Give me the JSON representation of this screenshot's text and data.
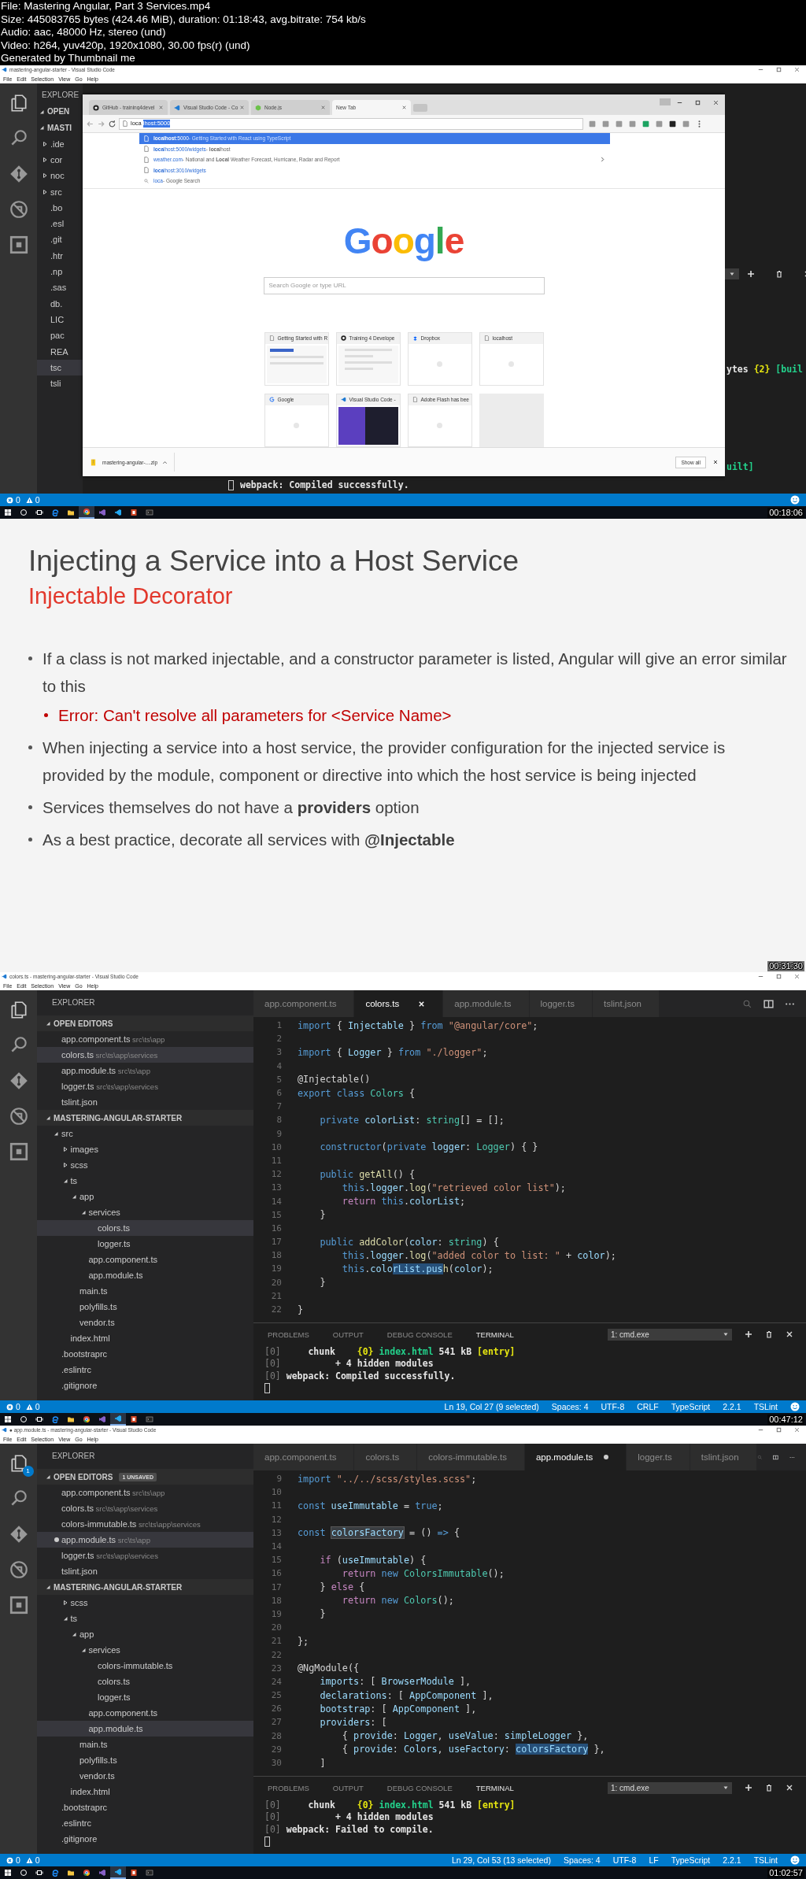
{
  "header_lines": [
    "File: Mastering Angular, Part 3 Services.mp4",
    "Size: 445083765 bytes (424.46 MiB), duration: 01:18:43, avg.bitrate: 754 kb/s",
    "Audio: aac, 48000 Hz, stereo (und)",
    "Video: h264, yuv420p, 1920x1080, 30.00 fps(r) (und)",
    "Generated by Thumbnail me"
  ],
  "frames": [
    {
      "kind": "browser",
      "title": "mastering-angular-starter - Visual Studio Code",
      "menu": [
        "File",
        "Edit",
        "Selection",
        "View",
        "Go",
        "Help"
      ],
      "sidebar_fragments": [
        {
          "kind": "header",
          "text": "EXPLORE",
          "selected": false
        },
        {
          "kind": "section",
          "text": "OPEN",
          "selected": false
        },
        {
          "kind": "section",
          "text": "MASTI",
          "selected": false
        },
        {
          "kind": "folder",
          "text": ".ide",
          "selected": false
        },
        {
          "kind": "folder",
          "text": "cor",
          "selected": false
        },
        {
          "kind": "folder",
          "text": "noc",
          "selected": false
        },
        {
          "kind": "folder",
          "text": "src",
          "selected": false
        },
        {
          "kind": "file",
          "text": ".bo",
          "selected": false
        },
        {
          "kind": "file",
          "text": ".esl",
          "selected": false
        },
        {
          "kind": "file",
          "text": ".git",
          "selected": false
        },
        {
          "kind": "file",
          "text": ".htr",
          "selected": false
        },
        {
          "kind": "file",
          "text": ".np",
          "selected": false
        },
        {
          "kind": "file",
          "text": ".sas",
          "selected": false
        },
        {
          "kind": "file",
          "text": "db.",
          "selected": false
        },
        {
          "kind": "file",
          "text": "LIC",
          "selected": false
        },
        {
          "kind": "file",
          "text": "pac",
          "selected": false
        },
        {
          "kind": "file",
          "text": "REA",
          "selected": false
        },
        {
          "kind": "file",
          "text": "tsc",
          "selected": true
        },
        {
          "kind": "file",
          "text": "tsli",
          "selected": false
        }
      ],
      "terminal_fragments": [
        {
          "segments": [
            {
              "kind": "bold",
              "text": "ytes "
            },
            {
              "kind": "yellow",
              "text": "{2}"
            },
            {
              "kind": "green",
              "text": " [buil"
            }
          ]
        },
        {
          "segments": [
            {
              "kind": "green",
              "text": "uilt]"
            }
          ]
        }
      ],
      "terminal_bottom": "webpack: Compiled successfully.",
      "browser": {
        "tabs": [
          {
            "kind": "github",
            "title": "GitHub - training4devel",
            "selected": false
          },
          {
            "kind": "vscode",
            "title": "Visual Studio Code - Co",
            "selected": false
          },
          {
            "kind": "node",
            "title": "Node.js",
            "selected": false
          },
          {
            "kind": "blank",
            "title": "New Tab",
            "selected": true
          }
        ],
        "address": {
          "typed": "loca",
          "completion": "lhost:5000"
        },
        "suggestions": [
          {
            "kind": "page",
            "url": "**localhost**:5000",
            "title": "- Getting Started with React using TypeScript",
            "selected": true,
            "expandable": false
          },
          {
            "kind": "page",
            "url": "**loca**lhost:5000/widgets",
            "title": "- **loca**lhost",
            "selected": false,
            "expandable": false
          },
          {
            "kind": "page",
            "url": "weather.com",
            "title": "- National and **Local** Weather Forecast, Hurricane, Radar and Report",
            "selected": false,
            "expandable": true
          },
          {
            "kind": "page",
            "url": "**loca**lhost:3010/widgets",
            "selected": false,
            "expandable": false
          },
          {
            "kind": "search",
            "url": "loca",
            "title": "- Google Search",
            "selected": false,
            "expandable": false
          }
        ],
        "logo": [
          {
            "char": "G",
            "color": "#4285f4"
          },
          {
            "char": "o",
            "color": "#ea4335"
          },
          {
            "char": "o",
            "color": "#fbbc05"
          },
          {
            "char": "g",
            "color": "#4285f4"
          },
          {
            "char": "l",
            "color": "#34a853"
          },
          {
            "char": "e",
            "color": "#ea4335"
          }
        ],
        "search_placeholder": "Search Google or type URL",
        "tiles": [
          {
            "kind": "page",
            "title": "Getting Started with R"
          },
          {
            "kind": "github",
            "title": "Training 4 Develope"
          },
          {
            "kind": "dropbox",
            "title": "Dropbox"
          },
          {
            "kind": "page",
            "title": "localhost"
          },
          {
            "kind": "google",
            "title": "Google"
          },
          {
            "kind": "vscode",
            "title": "Visual Studio Code -"
          },
          {
            "kind": "page",
            "title": "Adobe Flash has bee"
          },
          {
            "kind": "empty"
          }
        ],
        "download": {
          "file": "mastering-angular-....zip",
          "button": "Show all"
        }
      },
      "status": {
        "errors": "0",
        "warnings": "0"
      },
      "taskbar": [
        {
          "kind": "start",
          "active": false
        },
        {
          "kind": "search",
          "active": false
        },
        {
          "kind": "taskview",
          "active": false
        },
        {
          "kind": "edge",
          "active": false
        },
        {
          "kind": "folder",
          "active": false
        },
        {
          "kind": "chrome",
          "active": true
        },
        {
          "kind": "visualstudio",
          "active": false
        },
        {
          "kind": "vscode",
          "active": false
        },
        {
          "kind": "powerpoint",
          "active": false
        },
        {
          "kind": "terminal",
          "active": false
        }
      ],
      "timestamp": "00:18:06"
    },
    {
      "kind": "slide",
      "title": "Injecting a Service into a Host Service",
      "subtitle": "Injectable Decorator",
      "bullets": [
        {
          "text": "If a class is not marked injectable, and a constructor parameter is listed, Angular will give an error similar to this",
          "children": [
            {
              "text": "Error: Can't resolve all parameters for <Service Name>"
            }
          ]
        },
        {
          "text": "When injecting a service into a host service, the provider configuration for the injected service is provided by the module, component or directive into which the host service is being injected"
        },
        {
          "text": "Services themselves do not have a **providers** option"
        },
        {
          "text": "As a best practice, decorate all services with **@Injectable**"
        }
      ],
      "timestamp": "00:31:30"
    },
    {
      "kind": "editor",
      "title": "colors.ts - mastering-angular-starter - Visual Studio Code",
      "menu": [
        "File",
        "Edit",
        "Selection",
        "View",
        "Go",
        "Help"
      ],
      "explorer": {
        "title": "EXPLORER",
        "open_editors": {
          "label": "OPEN EDITORS",
          "items": [
            {
              "name": "app.component.ts",
              "path": "src\\ts\\app",
              "selected": false,
              "dirty": false
            },
            {
              "name": "colors.ts",
              "path": "src\\ts\\app\\services",
              "selected": true,
              "dirty": false
            },
            {
              "name": "app.module.ts",
              "path": "src\\ts\\app",
              "selected": false,
              "dirty": false
            },
            {
              "name": "logger.ts",
              "path": "src\\ts\\app\\services",
              "selected": false,
              "dirty": false
            },
            {
              "name": "tslint.json",
              "selected": false,
              "dirty": false
            }
          ]
        },
        "project": "MASTERING-ANGULAR-STARTER",
        "tree": [
          {
            "kind": "folder",
            "name": "src",
            "expanded": true,
            "selected": false,
            "children": [
              {
                "kind": "folder",
                "name": "images",
                "expanded": false,
                "selected": false
              },
              {
                "kind": "folder",
                "name": "scss",
                "expanded": false,
                "selected": false
              },
              {
                "kind": "folder",
                "name": "ts",
                "expanded": true,
                "selected": false,
                "children": [
                  {
                    "kind": "folder",
                    "name": "app",
                    "expanded": true,
                    "selected": false,
                    "children": [
                      {
                        "kind": "folder",
                        "name": "services",
                        "expanded": true,
                        "selected": false,
                        "children": [
                          {
                            "kind": "file",
                            "name": "colors.ts",
                            "selected": true
                          },
                          {
                            "kind": "file",
                            "name": "logger.ts",
                            "selected": false
                          }
                        ]
                      },
                      {
                        "kind": "file",
                        "name": "app.component.ts",
                        "selected": false
                      },
                      {
                        "kind": "file",
                        "name": "app.module.ts",
                        "selected": false
                      }
                    ]
                  },
                  {
                    "kind": "file",
                    "name": "main.ts",
                    "selected": false
                  },
                  {
                    "kind": "file",
                    "name": "polyfills.ts",
                    "selected": false
                  },
                  {
                    "kind": "file",
                    "name": "vendor.ts",
                    "selected": false
                  }
                ]
              },
              {
                "kind": "file",
                "name": "index.html",
                "selected": false
              }
            ]
          },
          {
            "kind": "file",
            "name": ".bootstraprc",
            "selected": false
          },
          {
            "kind": "file",
            "name": ".eslintrc",
            "selected": false
          },
          {
            "kind": "file",
            "name": ".gitignore",
            "selected": false
          }
        ]
      },
      "tabs": [
        {
          "name": "app.component.ts",
          "selected": false,
          "dirty": false
        },
        {
          "name": "colors.ts",
          "selected": true,
          "dirty": false
        },
        {
          "name": "app.module.ts",
          "selected": false,
          "dirty": false
        },
        {
          "name": "logger.ts",
          "selected": false,
          "dirty": false
        },
        {
          "name": "tslint.json",
          "selected": false,
          "dirty": false
        }
      ],
      "code": [
        {
          "number": "1",
          "tokens": [
            {
              "kind": "kw",
              "text": "import"
            },
            {
              "kind": "plain",
              "text": " { "
            },
            {
              "kind": "var",
              "text": "Injectable"
            },
            {
              "kind": "plain",
              "text": " } "
            },
            {
              "kind": "kw",
              "text": "from"
            },
            {
              "kind": "str",
              "text": " \"@angular/core\""
            },
            {
              "kind": "plain",
              "text": ";"
            }
          ]
        },
        {
          "number": "2"
        },
        {
          "number": "3",
          "tokens": [
            {
              "kind": "kw",
              "text": "import"
            },
            {
              "kind": "plain",
              "text": " { "
            },
            {
              "kind": "var",
              "text": "Logger"
            },
            {
              "kind": "plain",
              "text": " } "
            },
            {
              "kind": "kw",
              "text": "from"
            },
            {
              "kind": "str",
              "text": " \"./logger\""
            },
            {
              "kind": "plain",
              "text": ";"
            }
          ]
        },
        {
          "number": "4"
        },
        {
          "number": "5",
          "tokens": [
            {
              "kind": "plain",
              "text": "@Injectable()"
            }
          ]
        },
        {
          "number": "6",
          "tokens": [
            {
              "kind": "kw",
              "text": "export class"
            },
            {
              "kind": "type",
              "text": " Colors"
            },
            {
              "kind": "plain",
              "text": " {"
            }
          ]
        },
        {
          "number": "7"
        },
        {
          "number": "8",
          "tokens": [
            {
              "kind": "kw",
              "text": "    private"
            },
            {
              "kind": "var",
              "text": " colorList"
            },
            {
              "kind": "plain",
              "text": ": "
            },
            {
              "kind": "type",
              "text": "string"
            },
            {
              "kind": "plain",
              "text": "[] = [];"
            }
          ]
        },
        {
          "number": "9"
        },
        {
          "number": "10",
          "tokens": [
            {
              "kind": "kw",
              "text": "    constructor"
            },
            {
              "kind": "plain",
              "text": "("
            },
            {
              "kind": "kw",
              "text": "private"
            },
            {
              "kind": "var",
              "text": " logger"
            },
            {
              "kind": "plain",
              "text": ": "
            },
            {
              "kind": "type",
              "text": "Logger"
            },
            {
              "kind": "plain",
              "text": ") { }"
            }
          ]
        },
        {
          "number": "11"
        },
        {
          "number": "12",
          "tokens": [
            {
              "kind": "kw",
              "text": "    public"
            },
            {
              "kind": "fn",
              "text": " getAll"
            },
            {
              "kind": "plain",
              "text": "() {"
            }
          ]
        },
        {
          "number": "13",
          "tokens": [
            {
              "kind": "kw",
              "text": "        this"
            },
            {
              "kind": "plain",
              "text": "."
            },
            {
              "kind": "var",
              "text": "logger"
            },
            {
              "kind": "plain",
              "text": "."
            },
            {
              "kind": "fn",
              "text": "log"
            },
            {
              "kind": "plain",
              "text": "("
            },
            {
              "kind": "str",
              "text": "\"retrieved color list\""
            },
            {
              "kind": "plain",
              "text": ");"
            }
          ]
        },
        {
          "number": "14",
          "tokens": [
            {
              "kind": "ctrl",
              "text": "        return"
            },
            {
              "kind": "kw",
              "text": " this"
            },
            {
              "kind": "plain",
              "text": "."
            },
            {
              "kind": "var",
              "text": "colorList"
            },
            {
              "kind": "plain",
              "text": ";"
            }
          ]
        },
        {
          "number": "15",
          "tokens": [
            {
              "kind": "plain",
              "text": "    }"
            }
          ]
        },
        {
          "number": "16"
        },
        {
          "number": "17",
          "tokens": [
            {
              "kind": "kw",
              "text": "    public"
            },
            {
              "kind": "fn",
              "text": " addColor"
            },
            {
              "kind": "plain",
              "text": "("
            },
            {
              "kind": "var",
              "text": "color"
            },
            {
              "kind": "plain",
              "text": ": "
            },
            {
              "kind": "type",
              "text": "string"
            },
            {
              "kind": "plain",
              "text": ") {"
            }
          ]
        },
        {
          "number": "18",
          "tokens": [
            {
              "kind": "kw",
              "text": "        this"
            },
            {
              "kind": "plain",
              "text": "."
            },
            {
              "kind": "var",
              "text": "logger"
            },
            {
              "kind": "plain",
              "text": "."
            },
            {
              "kind": "fn",
              "text": "log"
            },
            {
              "kind": "plain",
              "text": "("
            },
            {
              "kind": "str",
              "text": "\"added color to list: \""
            },
            {
              "kind": "plain",
              "text": " + "
            },
            {
              "kind": "var",
              "text": "color"
            },
            {
              "kind": "plain",
              "text": ");"
            }
          ]
        },
        {
          "number": "19",
          "tokens": [
            {
              "kind": "kw",
              "text": "        this"
            },
            {
              "kind": "plain",
              "text": "."
            },
            {
              "kind": "var",
              "text": "colo"
            },
            {
              "kind": "sel",
              "text": "rList.pus"
            },
            {
              "kind": "fn",
              "text": "h"
            },
            {
              "kind": "plain",
              "text": "("
            },
            {
              "kind": "var",
              "text": "color"
            },
            {
              "kind": "plain",
              "text": ");"
            }
          ]
        },
        {
          "number": "20",
          "tokens": [
            {
              "kind": "plain",
              "text": "    }"
            }
          ]
        },
        {
          "number": "21"
        },
        {
          "number": "22",
          "tokens": [
            {
              "kind": "plain",
              "text": "}"
            }
          ]
        }
      ],
      "panel": {
        "tabs": [
          {
            "label": "PROBLEMS",
            "selected": false
          },
          {
            "label": "OUTPUT",
            "selected": false
          },
          {
            "label": "DEBUG CONSOLE",
            "selected": false
          },
          {
            "label": "TERMINAL",
            "selected": true
          }
        ],
        "terminal_select": "1: cmd.exe",
        "lines": [
          {
            "segments": [
              {
                "kind": "dim",
                "text": "[0]"
              },
              {
                "kind": "bold",
                "text": "     chunk    "
              },
              {
                "kind": "yellow",
                "text": "{0}"
              },
              {
                "kind": "green",
                "text": " index.html"
              },
              {
                "kind": "bold",
                "text": " 541 kB "
              },
              {
                "kind": "yellow",
                "text": "[entry]"
              }
            ]
          },
          {
            "segments": [
              {
                "kind": "dim",
                "text": "[0]"
              },
              {
                "kind": "bold",
                "text": "          + 4 hidden modules"
              }
            ]
          },
          {
            "segments": [
              {
                "kind": "dim",
                "text": "[0]"
              },
              {
                "kind": "bold",
                "text": " webpack: Compiled successfully."
              }
            ]
          }
        ]
      },
      "status": {
        "errors": "0",
        "warnings": "0",
        "items": [
          "Ln 19, Col 27 (9 selected)",
          "Spaces: 4",
          "UTF-8",
          "CRLF",
          "TypeScript",
          "2.2.1",
          "TSLint"
        ]
      },
      "taskbar": [
        {
          "kind": "start",
          "active": false
        },
        {
          "kind": "search",
          "active": false
        },
        {
          "kind": "taskview",
          "active": false
        },
        {
          "kind": "edge",
          "active": false
        },
        {
          "kind": "folder",
          "active": false
        },
        {
          "kind": "chrome",
          "active": false
        },
        {
          "kind": "visualstudio",
          "active": false
        },
        {
          "kind": "vscode",
          "active": true
        },
        {
          "kind": "powerpoint",
          "active": false
        },
        {
          "kind": "terminal",
          "active": false
        }
      ],
      "timestamp": "00:47:12"
    },
    {
      "kind": "editor",
      "title": "● app.module.ts - mastering-angular-starter - Visual Studio Code",
      "menu": [
        "File",
        "Edit",
        "Selection",
        "View",
        "Go",
        "Help"
      ],
      "explorer_badge": "1",
      "explorer": {
        "title": "EXPLORER",
        "open_editors": {
          "label": "OPEN EDITORS",
          "badge": "1 UNSAVED",
          "items": [
            {
              "name": "app.component.ts",
              "path": "src\\ts\\app",
              "selected": false,
              "dirty": false
            },
            {
              "name": "colors.ts",
              "path": "src\\ts\\app\\services",
              "selected": false,
              "dirty": false
            },
            {
              "name": "colors-immutable.ts",
              "path": "src\\ts\\app\\services",
              "selected": false,
              "dirty": false
            },
            {
              "name": "app.module.ts",
              "path": "src\\ts\\app",
              "selected": true,
              "dirty": true
            },
            {
              "name": "logger.ts",
              "path": "src\\ts\\app\\services",
              "selected": false,
              "dirty": false
            },
            {
              "name": "tslint.json",
              "selected": false,
              "dirty": false
            }
          ]
        },
        "project": "MASTERING-ANGULAR-STARTER",
        "tree": [
          {
            "children": [
              {
                "kind": "folder",
                "name": "scss",
                "expanded": false,
                "selected": false
              },
              {
                "kind": "folder",
                "name": "ts",
                "expanded": true,
                "selected": false,
                "children": [
                  {
                    "kind": "folder",
                    "name": "app",
                    "expanded": true,
                    "selected": false,
                    "children": [
                      {
                        "kind": "folder",
                        "name": "services",
                        "expanded": true,
                        "selected": false,
                        "children": [
                          {
                            "kind": "file",
                            "name": "colors-immutable.ts",
                            "selected": false
                          },
                          {
                            "kind": "file",
                            "name": "colors.ts",
                            "selected": false
                          },
                          {
                            "kind": "file",
                            "name": "logger.ts",
                            "selected": false
                          }
                        ]
                      },
                      {
                        "kind": "file",
                        "name": "app.component.ts",
                        "selected": false
                      },
                      {
                        "kind": "file",
                        "name": "app.module.ts",
                        "selected": true
                      }
                    ]
                  },
                  {
                    "kind": "file",
                    "name": "main.ts",
                    "selected": false
                  },
                  {
                    "kind": "file",
                    "name": "polyfills.ts",
                    "selected": false
                  },
                  {
                    "kind": "file",
                    "name": "vendor.ts",
                    "selected": false
                  }
                ]
              },
              {
                "kind": "file",
                "name": "index.html",
                "selected": false
              }
            ]
          },
          {
            "kind": "file",
            "name": ".bootstraprc",
            "selected": false
          },
          {
            "kind": "file",
            "name": ".eslintrc",
            "selected": false
          },
          {
            "kind": "file",
            "name": ".gitignore",
            "selected": false
          }
        ]
      },
      "tabs": [
        {
          "name": "app.component.ts",
          "selected": false,
          "dirty": false
        },
        {
          "name": "colors.ts",
          "selected": false,
          "dirty": false
        },
        {
          "name": "colors-immutable.ts",
          "selected": false,
          "dirty": false
        },
        {
          "name": "app.module.ts",
          "selected": true,
          "dirty": true
        },
        {
          "name": "logger.ts",
          "selected": false,
          "dirty": false
        },
        {
          "name": "tslint.json",
          "selected": false,
          "dirty": false
        }
      ],
      "code": [
        {
          "number": "9",
          "tokens": [
            {
              "kind": "kw",
              "text": "import"
            },
            {
              "kind": "str",
              "text": " \"../../scss/styles.scss\""
            },
            {
              "kind": "plain",
              "text": ";"
            }
          ]
        },
        {
          "number": "10"
        },
        {
          "number": "11",
          "tokens": [
            {
              "kind": "kw",
              "text": "const"
            },
            {
              "kind": "var",
              "text": " useImmutable"
            },
            {
              "kind": "plain",
              "text": " = "
            },
            {
              "kind": "kw",
              "text": "true"
            },
            {
              "kind": "plain",
              "text": ";"
            }
          ]
        },
        {
          "number": "12"
        },
        {
          "number": "13",
          "tokens": [
            {
              "kind": "kw",
              "text": "const "
            },
            {
              "kind": "hl",
              "text": "colorsFactory"
            },
            {
              "kind": "plain",
              "text": " = () "
            },
            {
              "kind": "kw",
              "text": "=>"
            },
            {
              "kind": "plain",
              "text": " {"
            }
          ]
        },
        {
          "number": "14"
        },
        {
          "number": "15",
          "tokens": [
            {
              "kind": "ctrl",
              "text": "    if"
            },
            {
              "kind": "plain",
              "text": " ("
            },
            {
              "kind": "var",
              "text": "useImmutable"
            },
            {
              "kind": "plain",
              "text": ") {"
            }
          ]
        },
        {
          "number": "16",
          "tokens": [
            {
              "kind": "ctrl",
              "text": "        return"
            },
            {
              "kind": "kw",
              "text": " new"
            },
            {
              "kind": "type",
              "text": " ColorsImmutable"
            },
            {
              "kind": "plain",
              "text": "();"
            }
          ]
        },
        {
          "number": "17",
          "tokens": [
            {
              "kind": "plain",
              "text": "    } "
            },
            {
              "kind": "ctrl",
              "text": "else"
            },
            {
              "kind": "plain",
              "text": " {"
            }
          ]
        },
        {
          "number": "18",
          "tokens": [
            {
              "kind": "ctrl",
              "text": "        return"
            },
            {
              "kind": "kw",
              "text": " new"
            },
            {
              "kind": "type",
              "text": " Colors"
            },
            {
              "kind": "plain",
              "text": "();"
            }
          ]
        },
        {
          "number": "19",
          "tokens": [
            {
              "kind": "plain",
              "text": "    }"
            }
          ]
        },
        {
          "number": "20"
        },
        {
          "number": "21",
          "tokens": [
            {
              "kind": "plain",
              "text": "};"
            }
          ]
        },
        {
          "number": "22"
        },
        {
          "number": "23",
          "tokens": [
            {
              "kind": "plain",
              "text": "@NgModule({"
            }
          ]
        },
        {
          "number": "24",
          "tokens": [
            {
              "kind": "var",
              "text": "    imports"
            },
            {
              "kind": "plain",
              "text": ": [ "
            },
            {
              "kind": "var",
              "text": "BrowserModule"
            },
            {
              "kind": "plain",
              "text": " ],"
            }
          ]
        },
        {
          "number": "25",
          "tokens": [
            {
              "kind": "var",
              "text": "    declarations"
            },
            {
              "kind": "plain",
              "text": ": [ "
            },
            {
              "kind": "var",
              "text": "AppComponent"
            },
            {
              "kind": "plain",
              "text": " ],"
            }
          ]
        },
        {
          "number": "26",
          "tokens": [
            {
              "kind": "var",
              "text": "    bootstrap"
            },
            {
              "kind": "plain",
              "text": ": [ "
            },
            {
              "kind": "var",
              "text": "AppComponent"
            },
            {
              "kind": "plain",
              "text": " ],"
            }
          ]
        },
        {
          "number": "27",
          "tokens": [
            {
              "kind": "var",
              "text": "    providers"
            },
            {
              "kind": "plain",
              "text": ": ["
            }
          ]
        },
        {
          "number": "28",
          "tokens": [
            {
              "kind": "plain",
              "text": "        { "
            },
            {
              "kind": "var",
              "text": "provide"
            },
            {
              "kind": "plain",
              "text": ": "
            },
            {
              "kind": "var",
              "text": "Logger"
            },
            {
              "kind": "plain",
              "text": ", "
            },
            {
              "kind": "var",
              "text": "useValue"
            },
            {
              "kind": "plain",
              "text": ": "
            },
            {
              "kind": "var",
              "text": "simpleLogger"
            },
            {
              "kind": "plain",
              "text": " },"
            }
          ]
        },
        {
          "number": "29",
          "tokens": [
            {
              "kind": "plain",
              "text": "        { "
            },
            {
              "kind": "var",
              "text": "provide"
            },
            {
              "kind": "plain",
              "text": ": "
            },
            {
              "kind": "var",
              "text": "Colors"
            },
            {
              "kind": "plain",
              "text": ", "
            },
            {
              "kind": "var",
              "text": "useFactory"
            },
            {
              "kind": "plain",
              "text": ": "
            },
            {
              "kind": "sel",
              "text": "colorsFactory"
            },
            {
              "kind": "plain",
              "text": " },"
            }
          ]
        },
        {
          "number": "30",
          "tokens": [
            {
              "kind": "plain",
              "text": "    ]"
            }
          ]
        }
      ],
      "panel": {
        "tabs": [
          {
            "label": "PROBLEMS",
            "selected": false
          },
          {
            "label": "OUTPUT",
            "selected": false
          },
          {
            "label": "DEBUG CONSOLE",
            "selected": false
          },
          {
            "label": "TERMINAL",
            "selected": true
          }
        ],
        "terminal_select": "1: cmd.exe",
        "lines": [
          {
            "segments": [
              {
                "kind": "dim",
                "text": "[0]"
              },
              {
                "kind": "bold",
                "text": "     chunk    "
              },
              {
                "kind": "yellow",
                "text": "{0}"
              },
              {
                "kind": "green",
                "text": " index.html"
              },
              {
                "kind": "bold",
                "text": " 541 kB "
              },
              {
                "kind": "yellow",
                "text": "[entry]"
              }
            ]
          },
          {
            "segments": [
              {
                "kind": "dim",
                "text": "[0]"
              },
              {
                "kind": "bold",
                "text": "          + 4 hidden modules"
              }
            ]
          },
          {
            "segments": [
              {
                "kind": "dim",
                "text": "[0]"
              },
              {
                "kind": "bold",
                "text": " webpack: Failed to compile."
              }
            ]
          }
        ]
      },
      "status": {
        "errors": "0",
        "warnings": "0",
        "items": [
          "Ln 29, Col 53 (13 selected)",
          "Spaces: 4",
          "UTF-8",
          "LF",
          "TypeScript",
          "2.2.1",
          "TSLint"
        ]
      },
      "taskbar": [
        {
          "kind": "start",
          "active": false
        },
        {
          "kind": "search",
          "active": false
        },
        {
          "kind": "taskview",
          "active": false
        },
        {
          "kind": "edge",
          "active": false
        },
        {
          "kind": "folder",
          "active": false
        },
        {
          "kind": "chrome",
          "active": false
        },
        {
          "kind": "visualstudio",
          "active": false
        },
        {
          "kind": "vscode",
          "active": true
        },
        {
          "kind": "powerpoint",
          "active": false
        },
        {
          "kind": "terminal",
          "active": false
        }
      ],
      "timestamp": "01:02:57"
    }
  ]
}
